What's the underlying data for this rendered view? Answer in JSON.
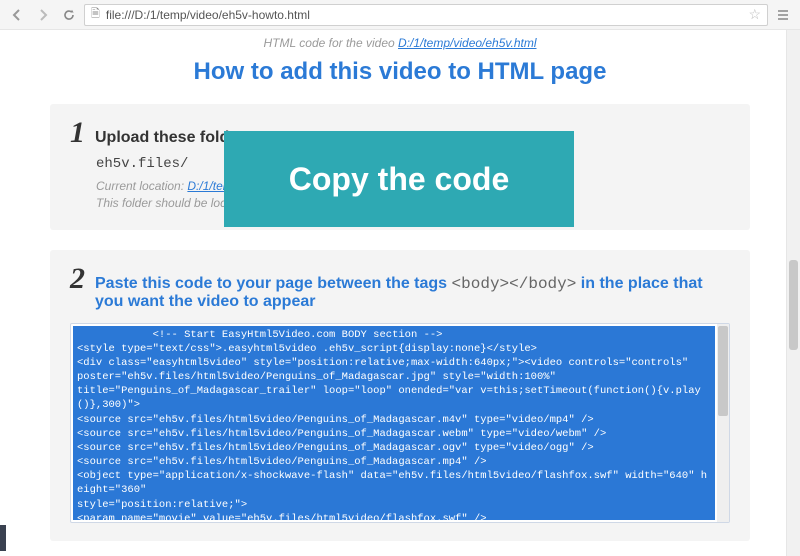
{
  "chrome": {
    "url": "file:///D:/1/temp/video/eh5v-howto.html"
  },
  "topline": {
    "intro": "HTML code for the video ",
    "link": "D:/1/temp/video/eh5v.html"
  },
  "heading": "How to add this video to HTML page",
  "step1": {
    "num": "1",
    "title": "Upload these folder to your server",
    "folder": "eh5v.files/",
    "loc_label": "Current location: ",
    "loc_link": "D:/1/tem",
    "hint2": "This folder should be loca"
  },
  "step2": {
    "num": "2",
    "title_a": "Paste this code to your page between the tags ",
    "tags": "<body></body>",
    "title_b": " in the place that you want the video to appear",
    "code": "            <!-- Start EasyHtml5Video.com BODY section -->\n<style type=\"text/css\">.easyhtml5video .eh5v_script{display:none}</style>\n<div class=\"easyhtml5video\" style=\"position:relative;max-width:640px;\"><video controls=\"controls\"\nposter=\"eh5v.files/html5video/Penguins_of_Madagascar.jpg\" style=\"width:100%\"\ntitle=\"Penguins_of_Madagascar_trailer\" loop=\"loop\" onended=\"var v=this;setTimeout(function(){v.play()},300)\">\n<source src=\"eh5v.files/html5video/Penguins_of_Madagascar.m4v\" type=\"video/mp4\" />\n<source src=\"eh5v.files/html5video/Penguins_of_Madagascar.webm\" type=\"video/webm\" />\n<source src=\"eh5v.files/html5video/Penguins_of_Madagascar.ogv\" type=\"video/ogg\" />\n<source src=\"eh5v.files/html5video/Penguins_of_Madagascar.mp4\" />\n<object type=\"application/x-shockwave-flash\" data=\"eh5v.files/html5video/flashfox.swf\" width=\"640\" height=\"360\"\nstyle=\"position:relative;\">\n<param name=\"movie\" value=\"eh5v.files/html5video/flashfox.swf\" />\n<param name=\"allowFullScreen\" value=\"true\" />\n<param name=\"flashVars\"\nvalue=\"autoplay=false&controls=true&fullScreenEnabled=true&posterOnEnd=true&loop=true&poster=eh5v.files/html5video/Penguins_of_Madagascar.jpg&src=Penguins_of_Madagascar.m4v\" />"
  },
  "overlay": "Copy the code"
}
